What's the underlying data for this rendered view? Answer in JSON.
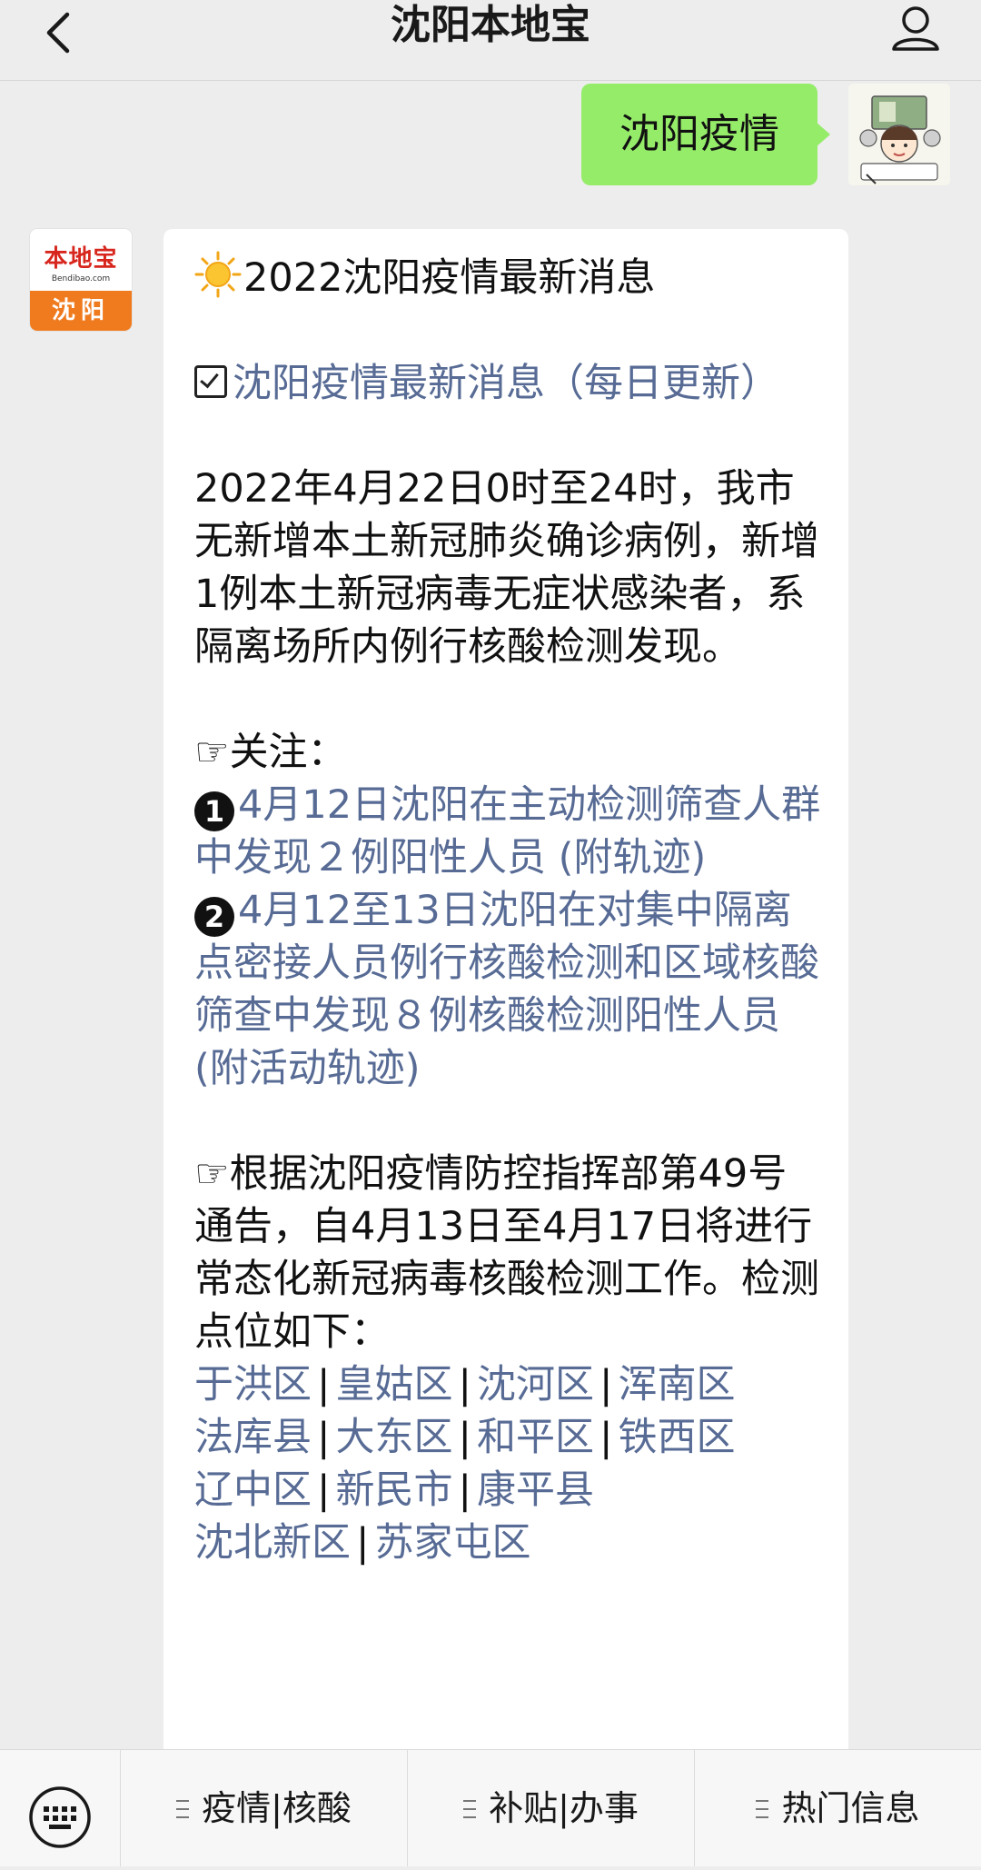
{
  "header": {
    "title": "沈阳本地宝"
  },
  "user_message": {
    "text": "沈阳疫情"
  },
  "bot_avatar": {
    "logo_text": "本地宝",
    "logo_sub": "Bendibao.com",
    "city": "沈阳"
  },
  "bot_message": {
    "headline_icon": "sun-icon",
    "headline": "2022沈阳疫情最新消息",
    "daily_link": "沈阳疫情最新消息（每日更新）",
    "report": "2022年4月22日0时至24时，我市无新增本土新冠肺炎确诊病例，新增1例本土新冠病毒无症状感染者，系隔离场所内例行核酸检测发现。",
    "focus_label": "关注：",
    "focus_items": [
      {
        "num": "1",
        "text": "4月12日沈阳在主动检测筛查人群中发现２例阳性人员 (附轨迹)"
      },
      {
        "num": "2",
        "text": "4月12至13日沈阳在对集中隔离点密接人员例行核酸检测和区域核酸筛查中发现８例核酸检测阳性人员 (附活动轨迹)"
      }
    ],
    "notice": "根据沈阳疫情防控指挥部第49号通告，自4月13日至4月17日将进行常态化新冠病毒核酸检测工作。检测点位如下：",
    "district_rows": [
      [
        "于洪区",
        "皇姑区",
        "沈河区",
        "浑南区"
      ],
      [
        "法库县",
        "大东区",
        "和平区",
        "铁西区"
      ],
      [
        "辽中区",
        "新民市",
        "康平县"
      ],
      [
        "沈北新区",
        "苏家屯区"
      ]
    ],
    "separator": "|"
  },
  "menu": {
    "items": [
      "疫情|核酸",
      "补贴|办事",
      "热门信息"
    ]
  },
  "colors": {
    "link": "#576b95",
    "user_bubble": "#95ec69",
    "background": "#ededed"
  }
}
